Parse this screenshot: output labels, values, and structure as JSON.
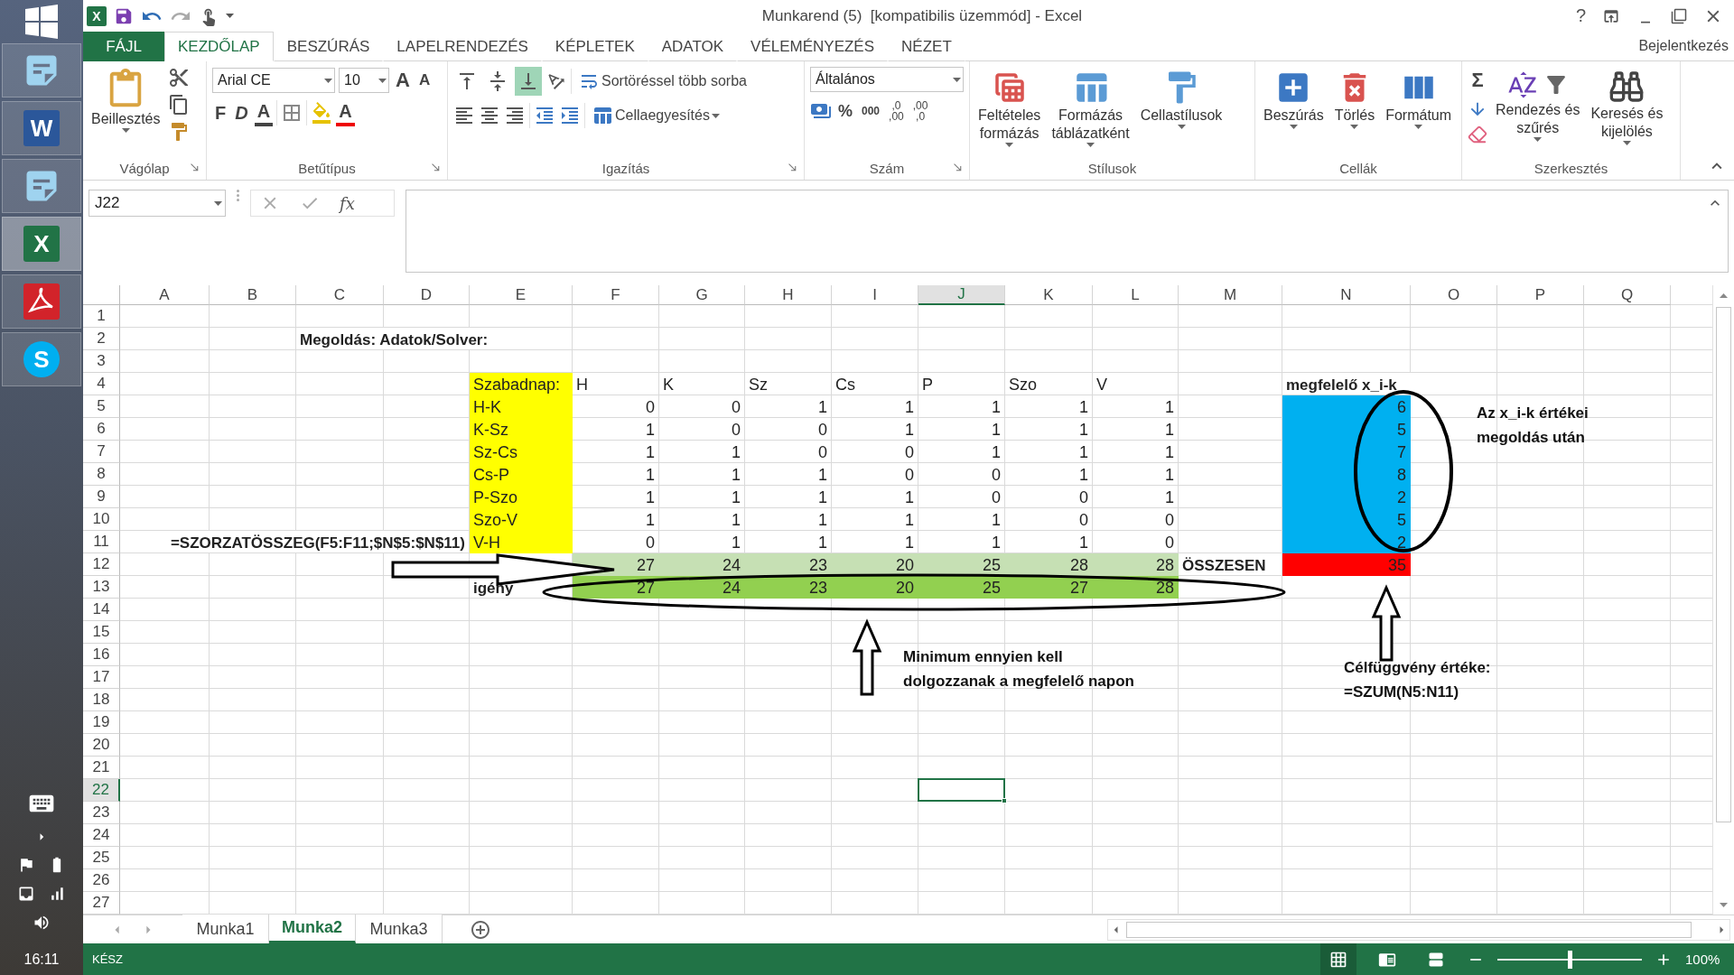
{
  "taskbar": {
    "apps": [
      {
        "kind": "notepad",
        "selected": false
      },
      {
        "kind": "word",
        "letter": "W",
        "selected": false
      },
      {
        "kind": "notepad",
        "selected": false
      },
      {
        "kind": "excel",
        "letter": "X",
        "selected": true
      },
      {
        "kind": "acrobat",
        "selected": false
      },
      {
        "kind": "skype",
        "letter": "S",
        "selected": false
      }
    ],
    "clock": "16:11"
  },
  "window": {
    "app_letter": "X",
    "title": "Munkarend (5)  [kompatibilis üzemmód] - Excel",
    "help": "?"
  },
  "ribbon_tabs": [
    {
      "label": "FÁJL",
      "kind": "file",
      "selected": false
    },
    {
      "label": "KEZDŐLAP",
      "kind": "tab",
      "selected": true
    },
    {
      "label": "BESZÚRÁS",
      "kind": "tab",
      "selected": false
    },
    {
      "label": "LAPELRENDEZÉS",
      "kind": "tab",
      "selected": false
    },
    {
      "label": "KÉPLETEK",
      "kind": "tab",
      "selected": false
    },
    {
      "label": "ADATOK",
      "kind": "tab",
      "selected": false
    },
    {
      "label": "VÉLEMÉNYEZÉS",
      "kind": "tab",
      "selected": false
    },
    {
      "label": "NÉZET",
      "kind": "tab",
      "selected": false
    }
  ],
  "sign_in": "Bejelentkezés",
  "ribbon": {
    "clipboard": {
      "label": "Vágólap",
      "paste": "Beillesztés"
    },
    "font": {
      "label": "Betűtípus",
      "font_name": "Arial CE",
      "font_size": "10",
      "grow": "A",
      "shrink": "A",
      "bold": "F",
      "italic": "D",
      "underline": "A",
      "font_color": "A"
    },
    "alignment": {
      "label": "Igazítás",
      "vertical": [
        {
          "selected": false
        },
        {
          "selected": false
        },
        {
          "selected": true
        }
      ],
      "wrap": "Sortöréssel több sorba",
      "merge": "Cellaegyesítés"
    },
    "number": {
      "label": "Szám",
      "format": "Általános",
      "percent": "%",
      "thousands": "000",
      "more_decimals": [
        ",0",
        ",00"
      ],
      "fewer_decimals": [
        ",00",
        ",0"
      ]
    },
    "styles": {
      "label": "Stílusok",
      "buttons": [
        {
          "kind": "conditional",
          "lines": [
            "Feltételes",
            "formázás"
          ]
        },
        {
          "kind": "table",
          "lines": [
            "Formázás",
            "táblázatként"
          ]
        },
        {
          "kind": "cellstyle",
          "lines": [
            "Cellastílusok"
          ]
        }
      ]
    },
    "cells": {
      "label": "Cellák",
      "buttons": [
        {
          "kind": "insert",
          "lines": [
            "Beszúrás"
          ]
        },
        {
          "kind": "delete",
          "lines": [
            "Törlés"
          ]
        },
        {
          "kind": "format",
          "lines": [
            "Formátum"
          ]
        }
      ]
    },
    "editing": {
      "label": "Szerkesztés",
      "sum": "Σ",
      "buttons": [
        {
          "kind": "sort",
          "lines": [
            "Rendezés és",
            "szűrés"
          ]
        },
        {
          "kind": "find",
          "lines": [
            "Keresés és",
            "kijelölés"
          ]
        }
      ]
    }
  },
  "formula_bar": {
    "name_box": "J22",
    "fx": "fx"
  },
  "sheet": {
    "columns": [
      {
        "label": "A",
        "selected": false
      },
      {
        "label": "B",
        "selected": false
      },
      {
        "label": "C",
        "selected": false
      },
      {
        "label": "D",
        "selected": false
      },
      {
        "label": "E",
        "selected": false
      },
      {
        "label": "F",
        "selected": false
      },
      {
        "label": "G",
        "selected": false
      },
      {
        "label": "H",
        "selected": false
      },
      {
        "label": "I",
        "selected": false
      },
      {
        "label": "J",
        "selected": true
      },
      {
        "label": "K",
        "selected": false
      },
      {
        "label": "L",
        "selected": false
      },
      {
        "label": "M",
        "selected": false
      },
      {
        "label": "N",
        "selected": false
      },
      {
        "label": "O",
        "selected": false
      },
      {
        "label": "P",
        "selected": false
      },
      {
        "label": "Q",
        "selected": false
      }
    ],
    "rows": [
      {
        "label": "1",
        "selected": false
      },
      {
        "label": "2",
        "selected": false
      },
      {
        "label": "3",
        "selected": false
      },
      {
        "label": "4",
        "selected": false
      },
      {
        "label": "5",
        "selected": false
      },
      {
        "label": "6",
        "selected": false
      },
      {
        "label": "7",
        "selected": false
      },
      {
        "label": "8",
        "selected": false
      },
      {
        "label": "9",
        "selected": false
      },
      {
        "label": "10",
        "selected": false
      },
      {
        "label": "11",
        "selected": false
      },
      {
        "label": "12",
        "selected": false
      },
      {
        "label": "13",
        "selected": false
      },
      {
        "label": "14",
        "selected": false
      },
      {
        "label": "15",
        "selected": false
      },
      {
        "label": "16",
        "selected": false
      },
      {
        "label": "17",
        "selected": false
      },
      {
        "label": "18",
        "selected": false
      },
      {
        "label": "19",
        "selected": false
      },
      {
        "label": "20",
        "selected": false
      },
      {
        "label": "21",
        "selected": false
      },
      {
        "label": "22",
        "selected": true
      },
      {
        "label": "23",
        "selected": false
      },
      {
        "label": "24",
        "selected": false
      },
      {
        "label": "25",
        "selected": false
      },
      {
        "label": "26",
        "selected": false
      },
      {
        "label": "27",
        "selected": false
      }
    ],
    "title": "Megoldás: Adatok/Solver:",
    "schedule": {
      "corner": "Szabadnap:",
      "days": [
        "H",
        "K",
        "Sz",
        "Cs",
        "P",
        "Szo",
        "V"
      ],
      "rows": [
        {
          "label": "H-K",
          "values": [
            "0",
            "0",
            "1",
            "1",
            "1",
            "1",
            "1"
          ]
        },
        {
          "label": "K-Sz",
          "values": [
            "1",
            "0",
            "0",
            "1",
            "1",
            "1",
            "1"
          ]
        },
        {
          "label": "Sz-Cs",
          "values": [
            "1",
            "1",
            "0",
            "0",
            "1",
            "1",
            "1"
          ]
        },
        {
          "label": "Cs-P",
          "values": [
            "1",
            "1",
            "1",
            "0",
            "0",
            "1",
            "1"
          ]
        },
        {
          "label": "P-Szo",
          "values": [
            "1",
            "1",
            "1",
            "1",
            "0",
            "0",
            "1"
          ]
        },
        {
          "label": "Szo-V",
          "values": [
            "1",
            "1",
            "1",
            "1",
            "1",
            "0",
            "0"
          ]
        },
        {
          "label": "V-H",
          "values": [
            "0",
            "1",
            "1",
            "1",
            "1",
            "1",
            "0"
          ]
        }
      ]
    },
    "formula_note": "=SZORZATÖSSZEG(F5:F11;$N$5:$N$11)",
    "totals": {
      "values": [
        "27",
        "24",
        "23",
        "20",
        "25",
        "28",
        "28"
      ],
      "label": "ÖSSZESEN",
      "objective": "35"
    },
    "demand": {
      "label": "igény",
      "values": [
        "27",
        "24",
        "23",
        "20",
        "25",
        "27",
        "28"
      ]
    },
    "solution": {
      "header": "megfelelő x_i-k",
      "values": [
        "6",
        "5",
        "7",
        "8",
        "2",
        "5",
        "2"
      ]
    },
    "notes": [
      {
        "lines": [
          "Az x_i-k értékei",
          "megoldás után"
        ]
      },
      {
        "lines": [
          "Minimum ennyien kell",
          "dolgozzanak a megfelelő napon"
        ]
      },
      {
        "lines": [
          "Célfüggvény értéke:",
          "=SZUM(N5:N11)"
        ]
      }
    ]
  },
  "sheet_tabs": [
    {
      "label": "Munka1",
      "selected": false
    },
    {
      "label": "Munka2",
      "selected": true
    },
    {
      "label": "Munka3",
      "selected": false
    }
  ],
  "status_bar": {
    "status": "KÉSZ",
    "views": [
      {
        "kind": "normal",
        "selected": true
      },
      {
        "kind": "page_layout",
        "selected": false
      },
      {
        "kind": "page_break",
        "selected": false
      }
    ],
    "zoom": {
      "level": 0.5,
      "reading": "100%"
    }
  }
}
